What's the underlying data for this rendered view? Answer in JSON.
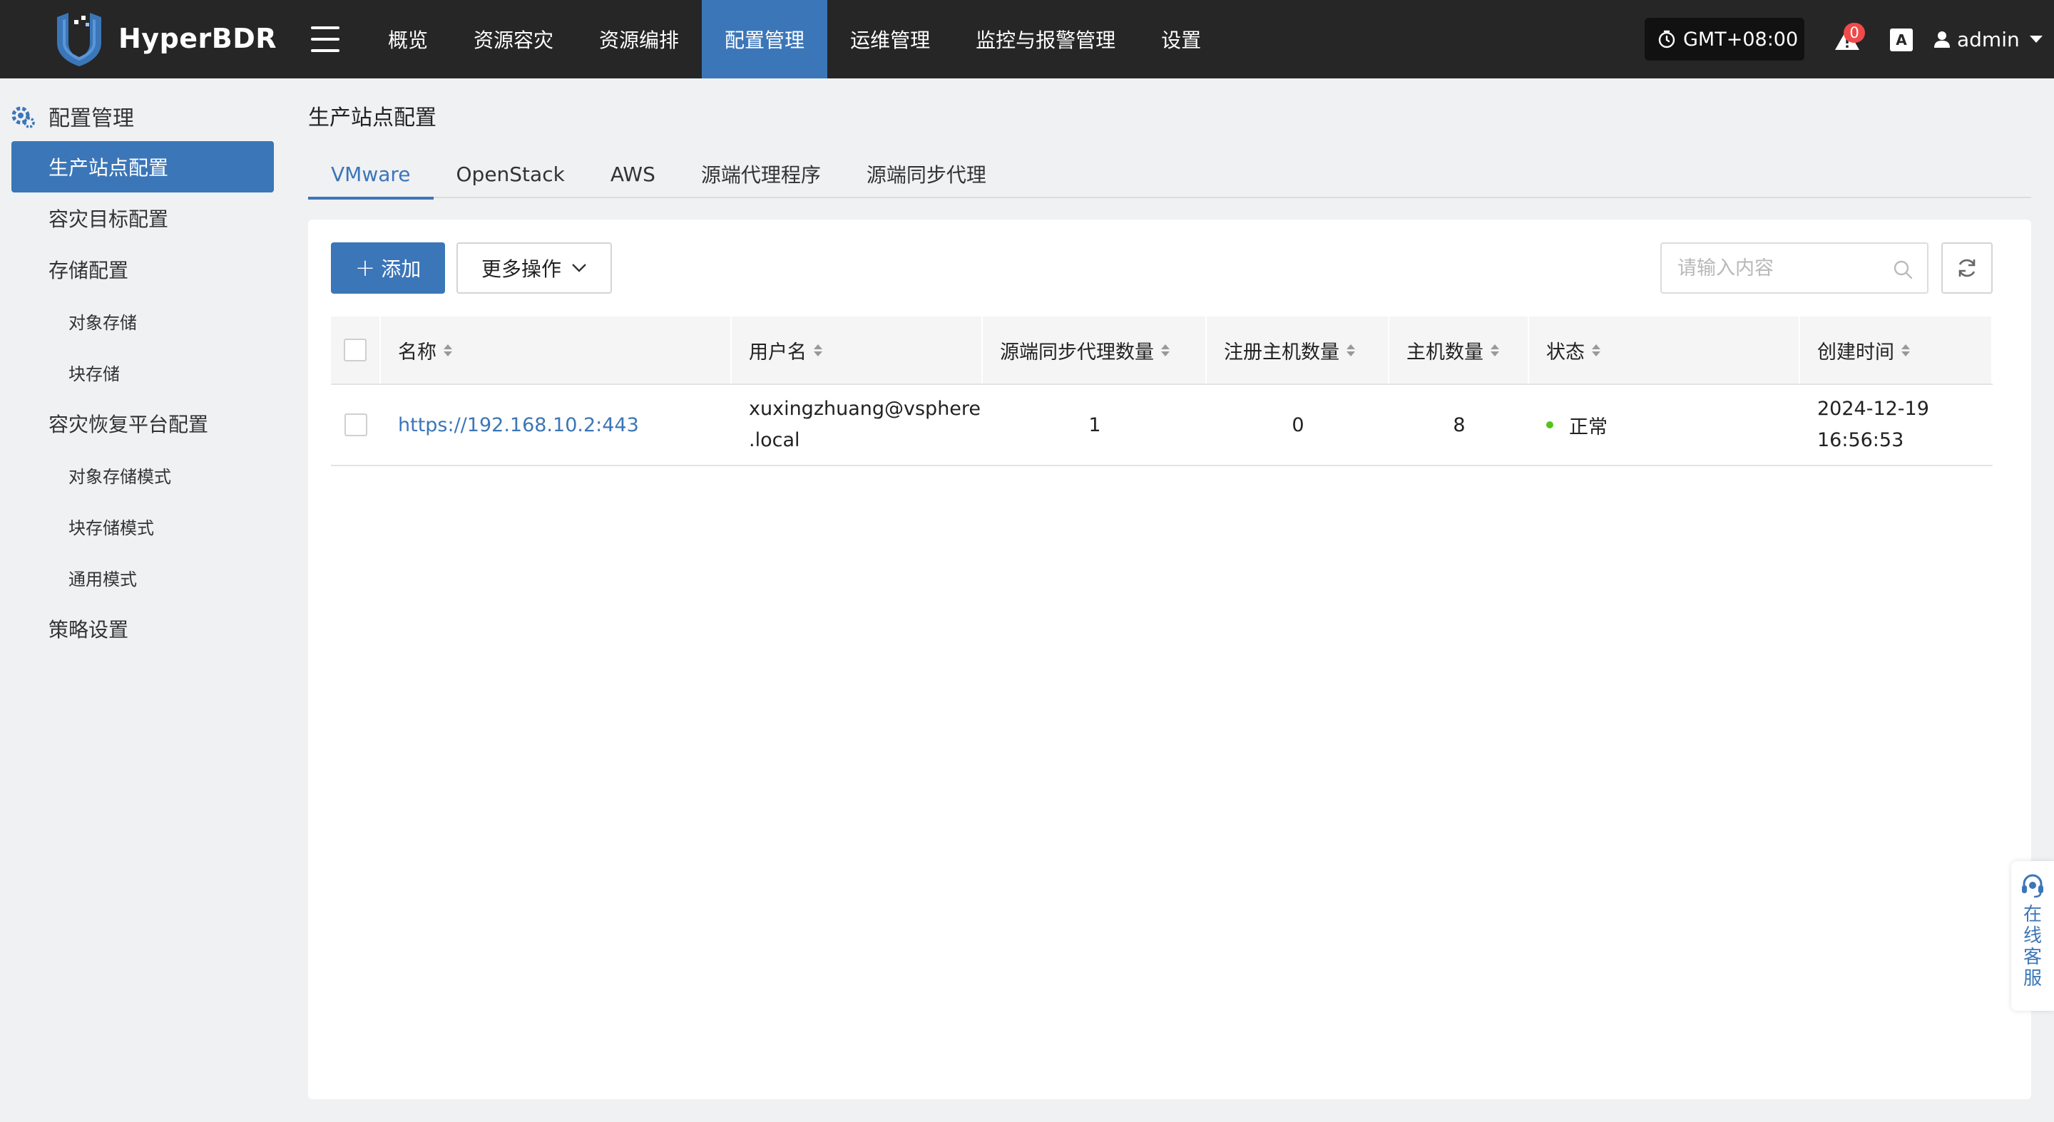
{
  "app": {
    "name": "HyperBDR"
  },
  "topnav": {
    "items": [
      "概览",
      "资源容灾",
      "资源编排",
      "配置管理",
      "运维管理",
      "监控与报警管理",
      "设置"
    ],
    "active_index": 3
  },
  "header": {
    "timezone": "GMT+08:00",
    "alert_count": "0",
    "lang_label": "A",
    "user": "admin"
  },
  "sidebar": {
    "title": "配置管理",
    "items": [
      {
        "label": "生产站点配置",
        "level": 1,
        "active": true
      },
      {
        "label": "容灾目标配置",
        "level": 1
      },
      {
        "label": "存储配置",
        "level": 1
      },
      {
        "label": "对象存储",
        "level": 2
      },
      {
        "label": "块存储",
        "level": 2
      },
      {
        "label": "容灾恢复平台配置",
        "level": 1
      },
      {
        "label": "对象存储模式",
        "level": 2
      },
      {
        "label": "块存储模式",
        "level": 2
      },
      {
        "label": "通用模式",
        "level": 2
      },
      {
        "label": "策略设置",
        "level": 1
      }
    ]
  },
  "main": {
    "title": "生产站点配置",
    "tabs": [
      "VMware",
      "OpenStack",
      "AWS",
      "源端代理程序",
      "源端同步代理"
    ],
    "active_tab": 0,
    "toolbar": {
      "add_label": "添加",
      "more_label": "更多操作",
      "search_placeholder": "请输入内容"
    },
    "table": {
      "columns": [
        "名称",
        "用户名",
        "源端同步代理数量",
        "注册主机数量",
        "主机数量",
        "状态",
        "创建时间"
      ],
      "rows": [
        {
          "name": "https://192.168.10.2:443",
          "username_l1": "xuxingzhuang@vsphere",
          "username_l2": ".local",
          "sync_agents": "1",
          "registered_hosts": "0",
          "hosts": "8",
          "status": "正常",
          "created_date": "2024-12-19",
          "created_time": "16:56:53"
        }
      ]
    }
  },
  "service": {
    "label": "在线客服"
  },
  "colors": {
    "accent": "#3b76b8",
    "topbar": "#262626",
    "status_ok": "#52c41a",
    "badge": "#f04a4a"
  }
}
